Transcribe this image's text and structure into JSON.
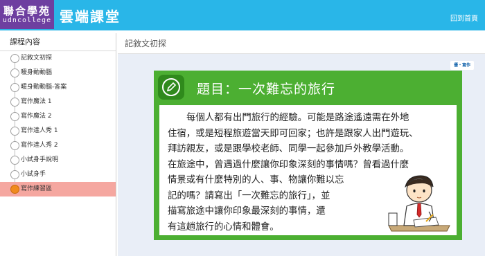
{
  "header": {
    "logo_cn": "聯合學苑",
    "logo_en": "udncollege",
    "site_title": "雲端課堂",
    "home_link": "回到首頁"
  },
  "sidebar": {
    "heading": "課程內容",
    "items": [
      {
        "label": "記敘文初探"
      },
      {
        "label": "暖身動動腦"
      },
      {
        "label": "暖身動動腦-答案"
      },
      {
        "label": "寫作魔法 1"
      },
      {
        "label": "寫作魔法 2"
      },
      {
        "label": "寫作達人秀 1"
      },
      {
        "label": "寫作達人秀 2"
      },
      {
        "label": "小試身手說明"
      },
      {
        "label": "小試身手"
      },
      {
        "label": "寫作練習區"
      }
    ],
    "active_index": 9
  },
  "main": {
    "heading": "記敘文初探",
    "badge": "優・寫作",
    "card": {
      "title": "題目：一次難忘的旅行",
      "lines": [
        "每個人都有出門旅行的經驗。可能是路途遙遠需在外地",
        "住宿，或是短程旅遊當天即可回家；也許是跟家人出門遊玩、",
        "拜訪親友，或是跟學校老師、同學一起參加戶外教學活動。",
        "在旅途中，曾遇過什麼讓你印象深刻的事情嗎？曾看過什麼",
        "情景或有什麼特別的人、事、物讓你難以忘",
        "記的嗎？請寫出「一次難忘的旅行」，並",
        "描寫旅途中讓你印象最深刻的事情，還",
        "有這趟旅行的心情和體會。"
      ]
    }
  },
  "colors": {
    "header": "#29b6e8",
    "logo": "#6e3fa0",
    "card": "#4caf32",
    "active_item": "#f5a7a0"
  }
}
